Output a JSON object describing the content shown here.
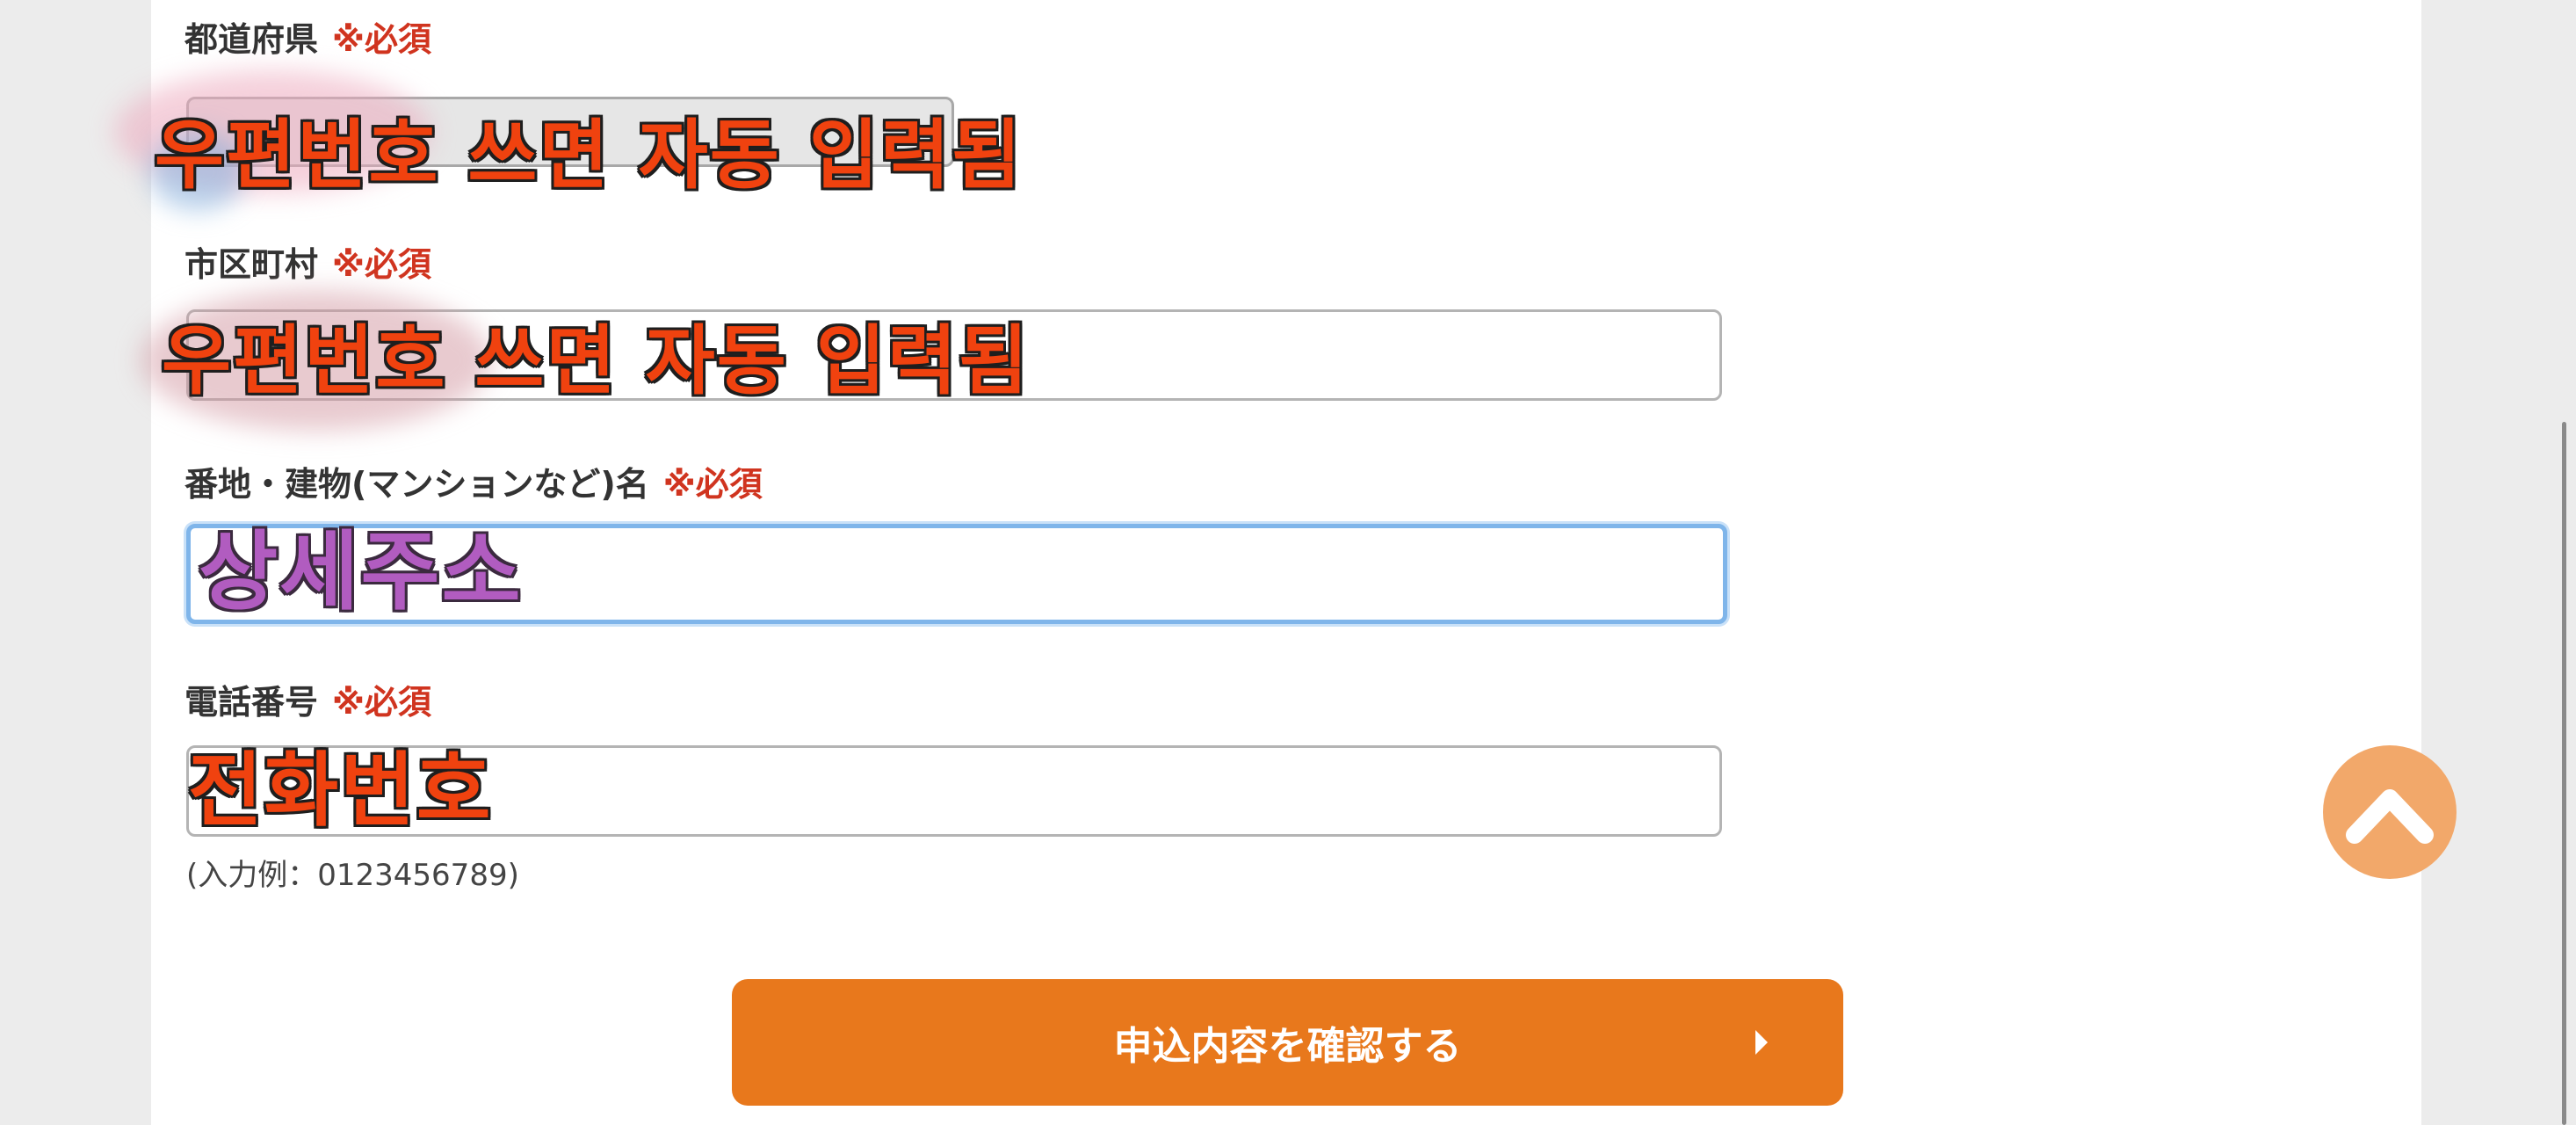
{
  "form": {
    "prefecture": {
      "label": "都道府県",
      "required": "※必須",
      "overlay": "우편번호 쓰면 자동 입력됨"
    },
    "city": {
      "label": "市区町村",
      "required": "※必須",
      "overlay": "우편번호 쓰면 자동 입력됨"
    },
    "address": {
      "label": "番地・建物(マンションなど)名",
      "required": "※必須",
      "overlay": "상세주소"
    },
    "phone": {
      "label": "電話番号",
      "required": "※必須",
      "overlay": "전화번호",
      "hint": "(入力例：0123456789)"
    }
  },
  "submit": {
    "label": "申込内容を確認する",
    "icon": "caret-right-icon"
  },
  "scroll_top": {
    "icon": "chevron-up-icon"
  },
  "colors": {
    "accent": "#e8781c",
    "required": "#d0341f",
    "focus": "#7fb5ea",
    "scroll_top_bg": "#f2a86a",
    "overlay_red": "#f0420f",
    "overlay_purple": "#b15cc0"
  }
}
